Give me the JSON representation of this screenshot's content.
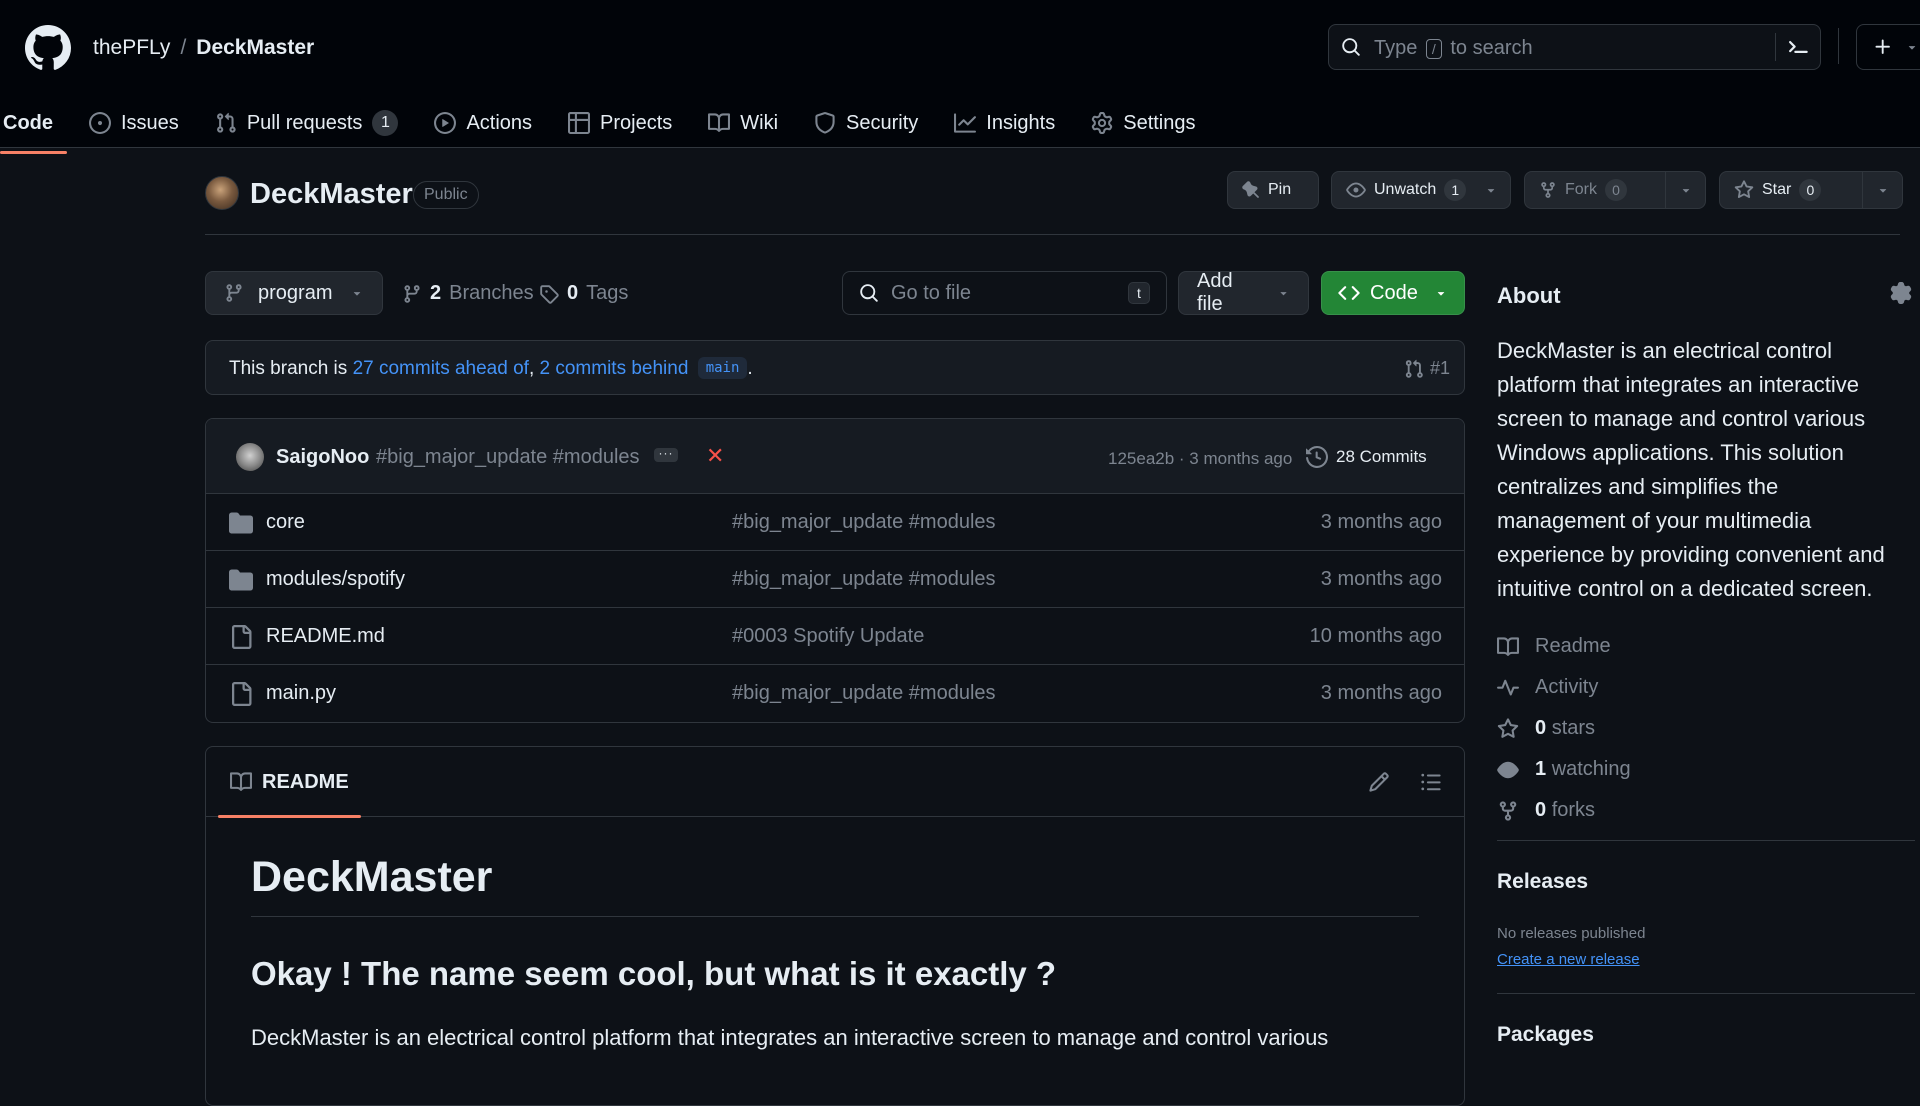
{
  "header": {
    "owner": "thePFLy",
    "separator": "/",
    "repo": "DeckMaster",
    "search": {
      "prefix": "Type",
      "key": "/",
      "suffix": "to search"
    }
  },
  "tabs": [
    {
      "label": "Code",
      "icon": "code-icon",
      "active": true
    },
    {
      "label": "Issues",
      "icon": "issue-icon"
    },
    {
      "label": "Pull requests",
      "icon": "pull-request-icon",
      "count": "1"
    },
    {
      "label": "Actions",
      "icon": "play-icon"
    },
    {
      "label": "Projects",
      "icon": "table-icon"
    },
    {
      "label": "Wiki",
      "icon": "book-icon"
    },
    {
      "label": "Security",
      "icon": "shield-icon"
    },
    {
      "label": "Insights",
      "icon": "graph-icon"
    },
    {
      "label": "Settings",
      "icon": "gear-icon"
    }
  ],
  "repo_header": {
    "name": "DeckMaster",
    "visibility": "Public",
    "pin": "Pin",
    "unwatch": "Unwatch",
    "watch_count": "1",
    "fork": "Fork",
    "fork_count": "0",
    "star": "Star",
    "star_count": "0"
  },
  "branch_bar": {
    "branch": "program",
    "branches_count": "2",
    "branches_label": "Branches",
    "tags_count": "0",
    "tags_label": "Tags",
    "go_to_file": "Go to file",
    "go_to_file_key": "t",
    "add_file": "Add file",
    "code": "Code"
  },
  "banner": {
    "prefix": "This branch is",
    "ahead": "27 commits ahead of",
    "comma": ",",
    "behind": "2 commits behind",
    "base": "main",
    "suffix": ".",
    "pr": "#1"
  },
  "latest_commit": {
    "author": "SaigoNoo",
    "message": "#big_major_update #modules",
    "status": "✕",
    "sha_time": "125ea2b · 3 months ago",
    "commits": "28 Commits"
  },
  "files": [
    {
      "name": "core",
      "type": "folder",
      "message": "#big_major_update #modules",
      "age": "3 months ago"
    },
    {
      "name": "modules/spotify",
      "type": "folder",
      "message": "#big_major_update #modules",
      "age": "3 months ago"
    },
    {
      "name": "README.md",
      "type": "file",
      "message": "#0003 Spotify Update",
      "age": "10 months ago"
    },
    {
      "name": "main.py",
      "type": "file",
      "message": "#big_major_update #modules",
      "age": "3 months ago"
    }
  ],
  "readme": {
    "tab": "README",
    "h1": "DeckMaster",
    "h2": "Okay ! The name seem cool, but what is it exactly ?",
    "p": "DeckMaster is an electrical control platform that integrates an interactive screen to manage and control various"
  },
  "about": {
    "title": "About",
    "description": "DeckMaster is an electrical control platform that integrates an interactive screen to manage and control various Windows applications. This solution centralizes and simplifies the management of your multimedia experience by providing convenient and intuitive control on a dedicated screen.",
    "readme": "Readme",
    "activity": "Activity",
    "stars_count": "0",
    "stars_label": "stars",
    "watching_count": "1",
    "watching_label": "watching",
    "forks_count": "0",
    "forks_label": "forks"
  },
  "releases": {
    "title": "Releases",
    "none": "No releases published",
    "create": "Create a new release"
  },
  "packages": {
    "title": "Packages"
  },
  "colors": {
    "accent": "#f78166",
    "link": "#4493f8",
    "green": "#238636",
    "bg": "#0d1117",
    "error": "#f85149"
  }
}
